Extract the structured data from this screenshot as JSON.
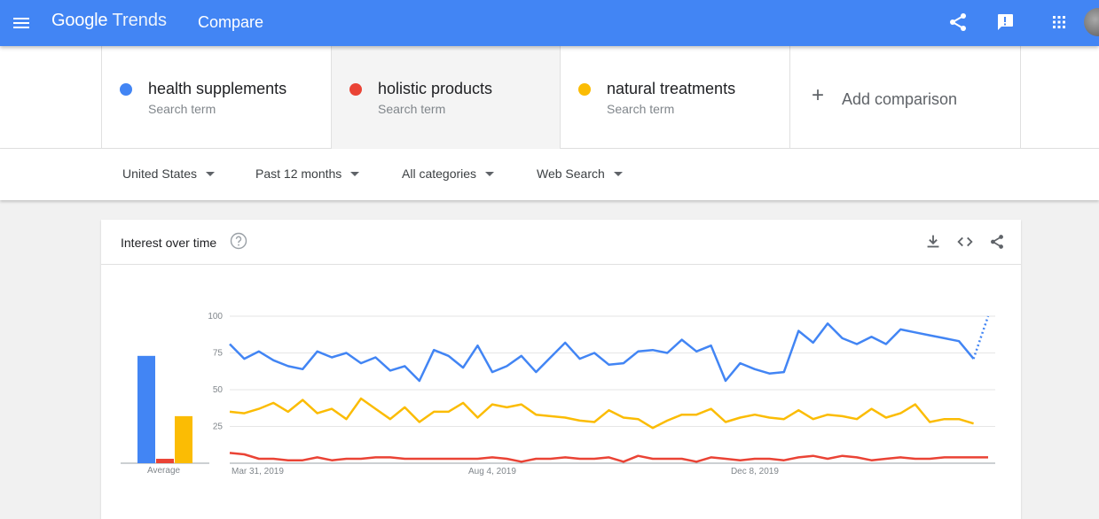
{
  "topbar": {
    "app_name_1": "Google",
    "app_name_2": "Trends",
    "page_title": "Compare",
    "bg_color": "#4285f4"
  },
  "terms": [
    {
      "name": "health supplements",
      "sub": "Search term",
      "color": "#4285f4"
    },
    {
      "name": "holistic products",
      "sub": "Search term",
      "color": "#ea4335"
    },
    {
      "name": "natural treatments",
      "sub": "Search term",
      "color": "#fbbc04"
    }
  ],
  "add_comparison": {
    "label": "Add comparison"
  },
  "filters": {
    "region": "United States",
    "time": "Past 12 months",
    "category": "All categories",
    "search_type": "Web Search"
  },
  "card": {
    "title": "Interest over time",
    "icons": [
      "help-icon",
      "download-icon",
      "embed-icon",
      "share-icon"
    ]
  },
  "chart_data": {
    "type": "line",
    "title": "Interest over time",
    "ylim": [
      0,
      100
    ],
    "yticks": [
      "100",
      "75",
      "50",
      "25"
    ],
    "xticks": [
      "Mar 31, 2019",
      "Aug 4, 2019",
      "Dec 8, 2019"
    ],
    "average_label": "Average",
    "grid": true,
    "averages": [
      73,
      3,
      32
    ],
    "series": [
      {
        "name": "health supplements",
        "color": "#4285f4",
        "values": [
          81,
          71,
          76,
          70,
          66,
          64,
          76,
          72,
          75,
          68,
          72,
          63,
          66,
          56,
          77,
          73,
          65,
          80,
          62,
          66,
          73,
          62,
          72,
          82,
          71,
          75,
          67,
          68,
          76,
          77,
          75,
          84,
          76,
          80,
          56,
          68,
          64,
          61,
          62,
          90,
          82,
          95,
          85,
          81,
          86,
          81,
          91,
          89,
          87,
          85,
          83,
          71,
          100
        ]
      },
      {
        "name": "holistic products",
        "color": "#ea4335",
        "values": [
          7,
          6,
          3,
          3,
          2,
          2,
          4,
          2,
          3,
          3,
          4,
          4,
          3,
          3,
          3,
          3,
          3,
          3,
          4,
          3,
          1,
          3,
          3,
          4,
          3,
          3,
          4,
          1,
          5,
          3,
          3,
          3,
          1,
          4,
          3,
          2,
          3,
          3,
          2,
          4,
          5,
          3,
          5,
          4,
          2,
          3,
          4,
          3,
          3,
          4,
          4,
          4,
          4
        ]
      },
      {
        "name": "natural treatments",
        "color": "#fbbc04",
        "values": [
          35,
          34,
          37,
          41,
          35,
          43,
          34,
          37,
          30,
          44,
          37,
          30,
          38,
          28,
          35,
          35,
          41,
          31,
          40,
          38,
          40,
          33,
          32,
          31,
          29,
          28,
          36,
          31,
          30,
          24,
          29,
          33,
          33,
          37,
          28,
          31,
          33,
          31,
          30,
          36,
          30,
          33,
          32,
          30,
          37,
          31,
          34,
          40,
          28,
          30,
          30,
          27
        ]
      }
    ]
  }
}
